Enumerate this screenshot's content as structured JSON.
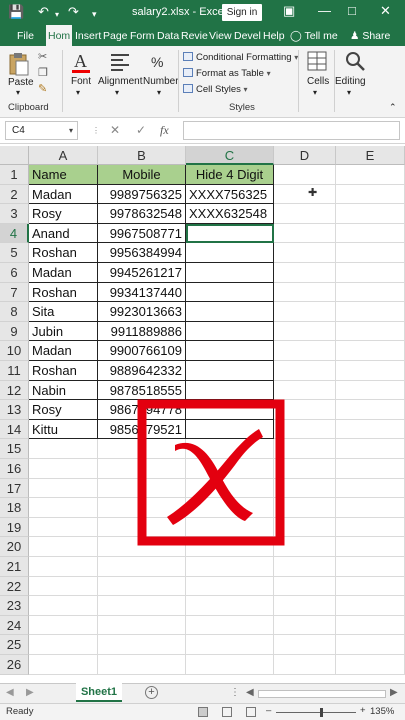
{
  "titlebar": {
    "filename": "salary2.xlsx  -  Excel",
    "signin": "Sign in",
    "save_icon": "save-icon",
    "undo_icon": "undo-icon",
    "redo_icon": "redo-icon"
  },
  "tabs": [
    "File",
    "Hom",
    "Insert",
    "Page",
    "Form",
    "Data",
    "Revie",
    "View",
    "Devel",
    "Help"
  ],
  "tell_me": "Tell me",
  "share": "Share",
  "ribbon": {
    "paste": "Paste",
    "clipboard": "Clipboard",
    "font": "Font",
    "alignment": "Alignment",
    "number": "Number",
    "conditional_formatting": "Conditional Formatting",
    "format_as_table": "Format as Table",
    "cell_styles": "Cell Styles",
    "styles": "Styles",
    "cells": "Cells",
    "editing": "Editing"
  },
  "formula_bar": {
    "name_box": "C4",
    "fx": "fx",
    "value": ""
  },
  "columns": [
    "A",
    "B",
    "C",
    "D",
    "E"
  ],
  "rows": [
    "1",
    "2",
    "3",
    "4",
    "5",
    "6",
    "7",
    "8",
    "9",
    "10",
    "11",
    "12",
    "13",
    "14",
    "15",
    "16",
    "17",
    "18",
    "19",
    "20",
    "21",
    "22",
    "23",
    "24",
    "25",
    "26"
  ],
  "table": {
    "headers": [
      "Name",
      "Mobile",
      "Hide 4 Digit"
    ],
    "names": [
      "Madan",
      "Rosy",
      "Anand",
      "Roshan",
      "Madan",
      "Roshan",
      "Sita",
      "Jubin",
      "Madan",
      "Roshan",
      "Nabin",
      "Rosy",
      "Kittu"
    ],
    "mobiles": [
      "9989756325",
      "9978632548",
      "9967508771",
      "9956384994",
      "9945261217",
      "9934137440",
      "9923013663",
      "9911889886",
      "9900766109",
      "9889642332",
      "9878518555",
      "9867394778",
      "9856279521"
    ],
    "hidden": [
      "XXXX756325",
      "XXXX632548",
      "",
      "",
      "",
      "",
      "",
      "",
      "",
      "",
      "",
      "",
      ""
    ]
  },
  "active_cell": "C4",
  "sheet": {
    "tab": "Sheet1"
  },
  "status": {
    "ready": "Ready",
    "zoom": "135%"
  },
  "overlay": {
    "color": "#e3000f",
    "icon": "red-cross-icon"
  }
}
